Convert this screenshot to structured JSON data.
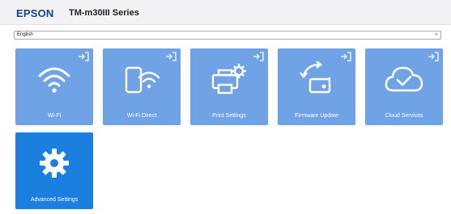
{
  "header": {
    "brand": "EPSON",
    "model": "TM-m30III Series"
  },
  "language": {
    "selected": "English"
  },
  "tiles": [
    {
      "label": "Wi-Fi",
      "icon": "wifi-icon"
    },
    {
      "label": "Wi-Fi Direct",
      "icon": "wifi-direct-icon"
    },
    {
      "label": "Print Settings",
      "icon": "print-settings-icon"
    },
    {
      "label": "Firmware Update",
      "icon": "firmware-update-icon"
    },
    {
      "label": "Cloud Services",
      "icon": "cloud-services-icon"
    },
    {
      "label": "Advanced Settings",
      "icon": "gear-icon"
    }
  ],
  "colors": {
    "tile": "#6fa3e6",
    "tile_active": "#1b7fe0",
    "brand": "#1b3f94"
  }
}
